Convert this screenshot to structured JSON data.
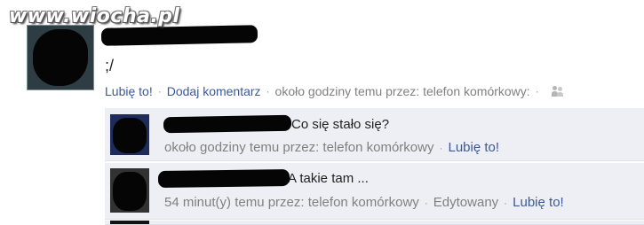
{
  "watermark": "www.wiocha.pl",
  "post": {
    "text": ";/",
    "like_link": "Lubię to!",
    "comment_link": "Dodaj komentarz",
    "timestamp": "około godziny temu przez: telefon komórkowy:",
    "separator": "·"
  },
  "comments": [
    {
      "text": "Co się stało się?",
      "meta": "około godziny temu przez: telefon komórkowy",
      "like_link": "Lubię to!"
    },
    {
      "text": "A takie tam ...",
      "meta": "54 minut(y) temu przez: telefon komórkowy",
      "edited": "Edytowany",
      "like_link": "Lubię to!"
    }
  ],
  "colors": {
    "link": "#3b5998",
    "meta": "#808080",
    "comment_bg": "#edeff4"
  },
  "icons": {
    "people": "people-icon"
  }
}
